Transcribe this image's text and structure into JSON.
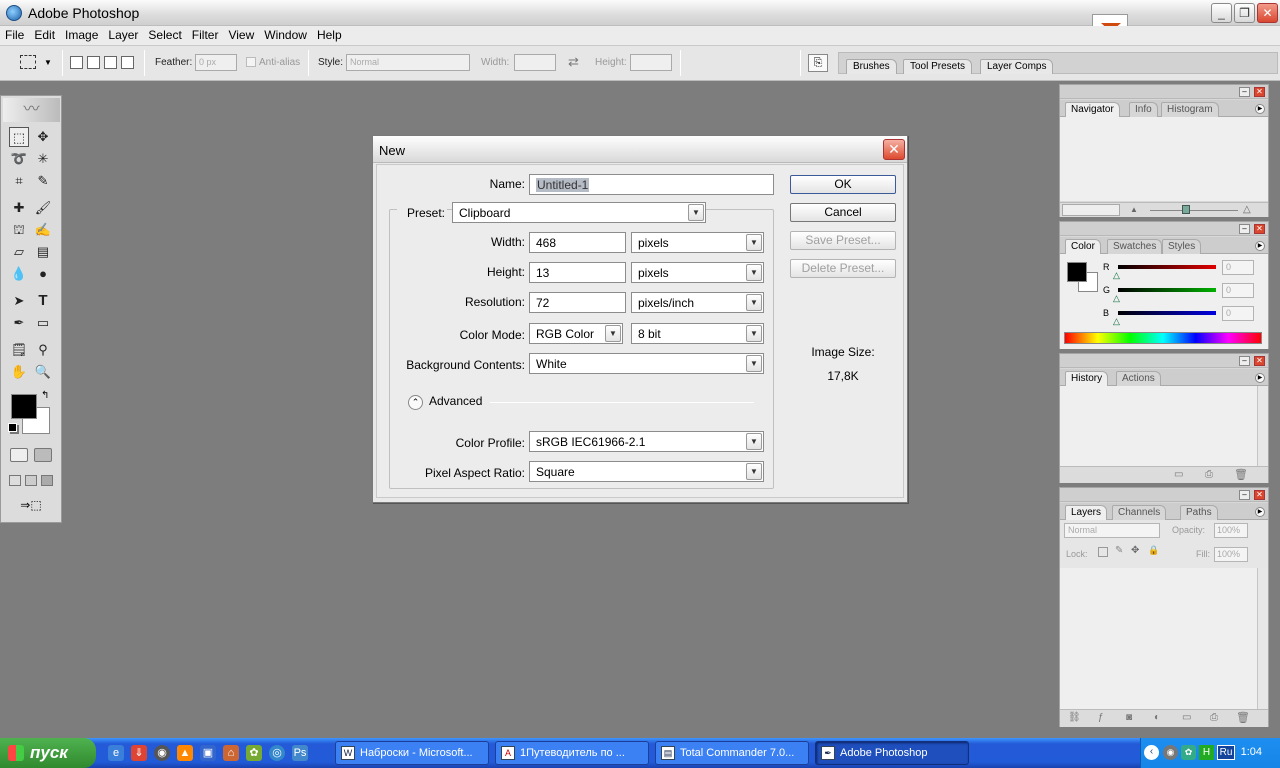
{
  "app": {
    "title": "Adobe Photoshop"
  },
  "menu": [
    "File",
    "Edit",
    "Image",
    "Layer",
    "Select",
    "Filter",
    "View",
    "Window",
    "Help"
  ],
  "options": {
    "feather_label": "Feather:",
    "feather_value": "0 px",
    "antialias_label": "Anti-alias",
    "style_label": "Style:",
    "style_value": "Normal",
    "width_label": "Width:",
    "height_label": "Height:"
  },
  "wells": {
    "tabs": [
      "Brushes",
      "Tool Presets",
      "Layer Comps"
    ]
  },
  "dialog": {
    "title": "New",
    "name_label": "Name:",
    "name_value": "Untitled-1",
    "preset_label": "Preset:",
    "preset_value": "Clipboard",
    "width_label": "Width:",
    "width_value": "468",
    "width_unit": "pixels",
    "height_label": "Height:",
    "height_value": "13",
    "height_unit": "pixels",
    "resolution_label": "Resolution:",
    "resolution_value": "72",
    "resolution_unit": "pixels/inch",
    "color_mode_label": "Color Mode:",
    "color_mode_value": "RGB Color",
    "bit_depth": "8 bit",
    "background_label": "Background Contents:",
    "background_value": "White",
    "advanced_label": "Advanced",
    "color_profile_label": "Color Profile:",
    "color_profile_value": "sRGB IEC61966-2.1",
    "pixel_aspect_label": "Pixel Aspect Ratio:",
    "pixel_aspect_value": "Square",
    "ok": "OK",
    "cancel": "Cancel",
    "save_preset": "Save Preset...",
    "delete_preset": "Delete Preset...",
    "image_size_label": "Image Size:",
    "image_size_value": "17,8K"
  },
  "panels": {
    "navigator_tabs": [
      "Navigator",
      "Info",
      "Histogram"
    ],
    "color_tabs": [
      "Color",
      "Swatches",
      "Styles"
    ],
    "color_channels": [
      {
        "label": "R",
        "value": "0",
        "color": "#e00000"
      },
      {
        "label": "G",
        "value": "0",
        "color": "#00b000"
      },
      {
        "label": "B",
        "value": "0",
        "color": "#0000e0"
      }
    ],
    "history_tabs": [
      "History",
      "Actions"
    ],
    "layers_tabs": [
      "Layers",
      "Channels",
      "Paths"
    ],
    "blend_mode": "Normal",
    "opacity_label": "Opacity:",
    "opacity_value": "100%",
    "lock_label": "Lock:",
    "fill_label": "Fill:",
    "fill_value": "100%"
  },
  "taskbar": {
    "start": "пуск",
    "tasks": [
      "Наброски - Microsoft...",
      "1Путеводитель по ...",
      "Total Commander 7.0...",
      "Adobe Photoshop"
    ],
    "tray_lang": "Ru",
    "clock": "1:04"
  }
}
